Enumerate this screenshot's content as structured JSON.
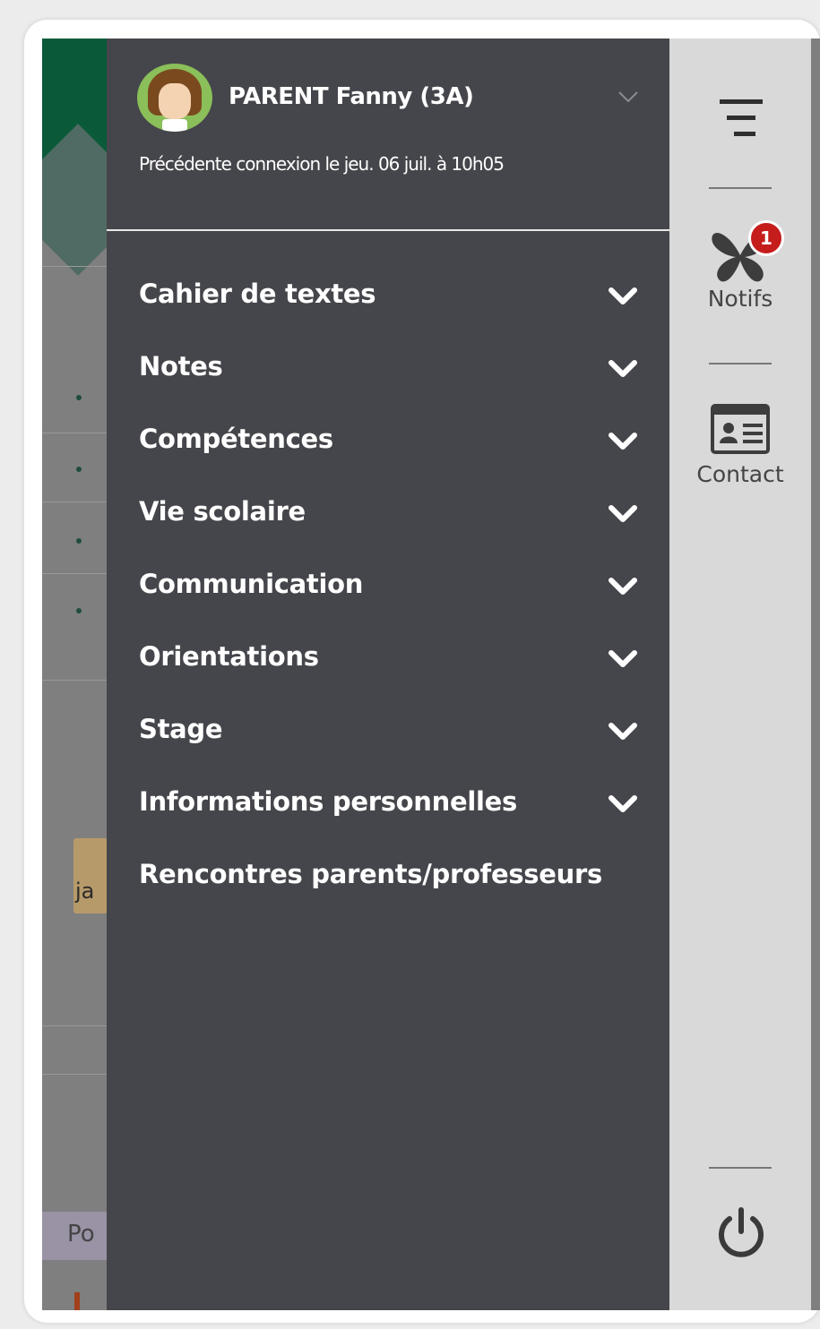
{
  "profile": {
    "name": "PARENT Fanny (3A)",
    "last_login": "Précédente connexion le jeu. 06 juil. à 10h05",
    "avatar_icon": "student-girl-avatar-icon",
    "expand_icon": "chevron-down-icon"
  },
  "menu": {
    "items": [
      {
        "label": "Cahier de textes",
        "has_submenu": true
      },
      {
        "label": "Notes",
        "has_submenu": true
      },
      {
        "label": "Compétences",
        "has_submenu": true
      },
      {
        "label": "Vie scolaire",
        "has_submenu": true
      },
      {
        "label": "Communication",
        "has_submenu": true
      },
      {
        "label": "Orientations",
        "has_submenu": true
      },
      {
        "label": "Stage",
        "has_submenu": true
      },
      {
        "label": "Informations personnelles",
        "has_submenu": true
      },
      {
        "label": "Rencontres parents/professeurs",
        "has_submenu": false
      }
    ]
  },
  "sidebar": {
    "notifs_label": "Notifs",
    "notifs_count": "1",
    "contact_label": "Contact",
    "icons": [
      "menu-lines-icon",
      "butterfly-notification-icon",
      "contact-card-icon",
      "power-icon"
    ]
  },
  "background": {
    "peek_text": "ja",
    "purple_text": "Po"
  },
  "colors": {
    "menu_bg": "#45464b",
    "sidebar_bg": "#d9d9d9",
    "badge": "#c51c1c",
    "header_green": "#0a5a3a"
  }
}
